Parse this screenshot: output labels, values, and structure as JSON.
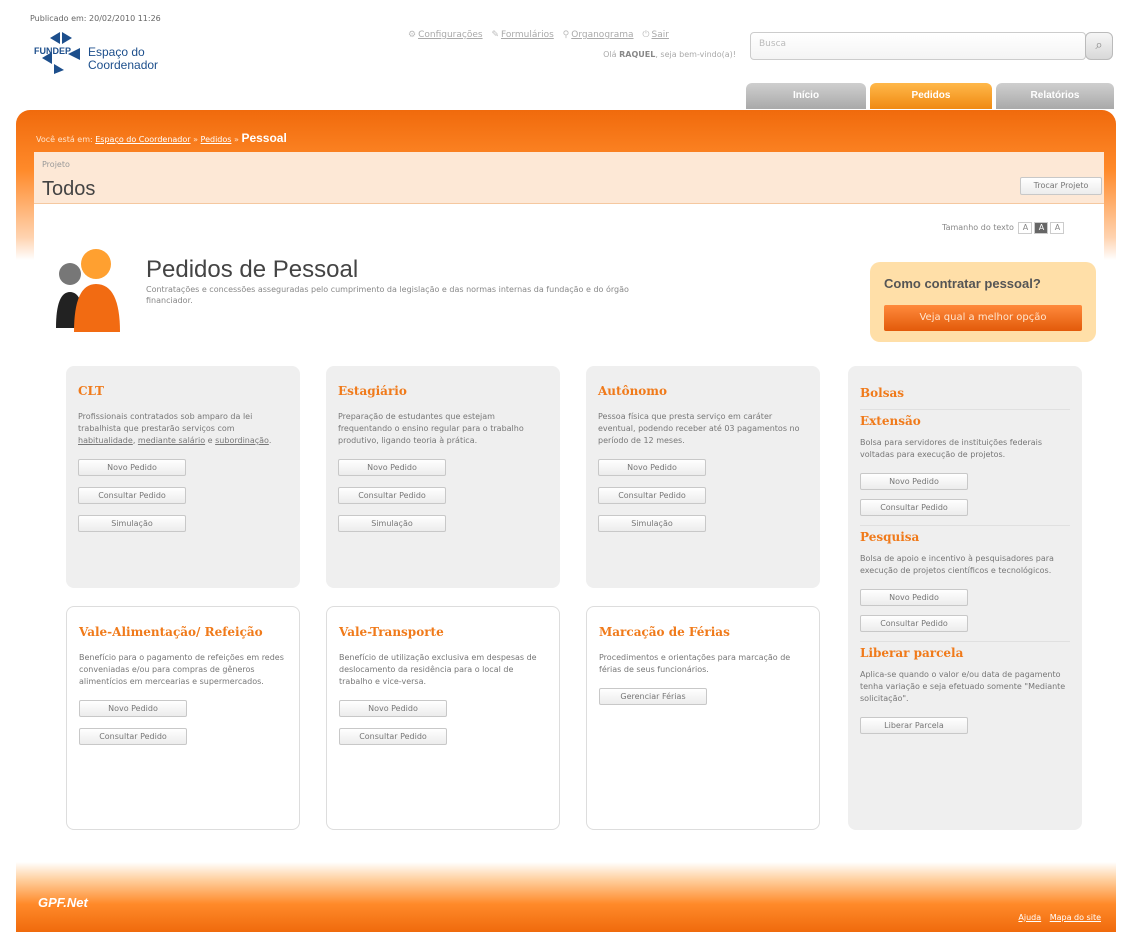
{
  "published": "Publicado em: 20/02/2010 11:26",
  "logo": {
    "brand": "FUNDEP",
    "line1": "Espaço do",
    "line2": "Coordenador"
  },
  "topnav": {
    "config": "Configurações",
    "forms": "Formulários",
    "org": "Organograma",
    "help": "Sair"
  },
  "greeting": {
    "prefix": "Olá",
    "name": "RAQUEL",
    "suffix": ", seja bem-vindo(a)!"
  },
  "search": {
    "placeholder": "Busca"
  },
  "tabs": [
    "Início",
    "Pedidos",
    "Relatórios"
  ],
  "breadcrumb": {
    "prefix": "Você está em:",
    "link1": "Espaço do Coordenador",
    "link2": "Pedidos",
    "current": "Pessoal"
  },
  "project": {
    "label": "Projeto",
    "name": "Todos",
    "change_button": "Trocar Projeto"
  },
  "text_size": {
    "label": "Tamanho do texto",
    "options": [
      "A",
      "A",
      "A"
    ]
  },
  "hero": {
    "title": "Pedidos de Pessoal",
    "description": "Contratações e concessões asseguradas pelo cumprimento da legislação e das normas internas da fundação e do órgão financiador."
  },
  "como": {
    "title": "Como contratar pessoal?",
    "button": "Veja qual a melhor opção"
  },
  "cards": {
    "clt": {
      "title": "CLT",
      "desc_pre": "Profissionais contratados sob amparo da lei trabalhista que prestarão serviços com ",
      "link1": "habitualidade",
      "mid": ", ",
      "link2": "mediante salário",
      "mid2": " e ",
      "link3": "subordinação",
      "end": ".",
      "buttons": [
        "Novo Pedido",
        "Consultar Pedido",
        "Simulação"
      ]
    },
    "estagiario": {
      "title": "Estagiário",
      "desc": "Preparação de estudantes que estejam frequentando o ensino regular para o trabalho produtivo, ligando teoria à prática.",
      "buttons": [
        "Novo Pedido",
        "Consultar Pedido",
        "Simulação"
      ]
    },
    "autonomo": {
      "title": "Autônomo",
      "desc": "Pessoa física que presta serviço em caráter eventual, podendo receber até 03 pagamentos no período de 12 meses.",
      "buttons": [
        "Novo Pedido",
        "Consultar Pedido",
        "Simulação"
      ]
    },
    "bolsas": {
      "title": "Bolsas",
      "extensao": {
        "title": "Extensão",
        "desc": "Bolsa para servidores de instituições federais voltadas para execução de projetos.",
        "buttons": [
          "Novo Pedido",
          "Consultar Pedido"
        ]
      },
      "pesquisa": {
        "title": "Pesquisa",
        "desc": "Bolsa de apoio e incentivo à pesquisadores para execução de projetos científicos e tecnológicos.",
        "buttons": [
          "Novo Pedido",
          "Consultar Pedido"
        ]
      },
      "liberar": {
        "title": "Liberar parcela",
        "desc": "Aplica-se quando o valor e/ou data de pagamento tenha variação e seja efetuado somente \"Mediante solicitação\".",
        "buttons": [
          "Liberar Parcela"
        ]
      }
    },
    "vale_alimentacao": {
      "title": "Vale-Alimentação/ Refeição",
      "desc": "Benefício para o pagamento de refeições em redes conveniadas e/ou para compras de gêneros alimentícios em mercearias e supermercados.",
      "buttons": [
        "Novo Pedido",
        "Consultar Pedido"
      ]
    },
    "vale_transporte": {
      "title": "Vale-Transporte",
      "desc": "Benefício de utilização exclusiva em despesas de deslocamento da residência para o local de trabalho e vice-versa.",
      "buttons": [
        "Novo Pedido",
        "Consultar Pedido"
      ]
    },
    "ferias": {
      "title": "Marcação de Férias",
      "desc": "Procedimentos e orientações para marcação de férias de seus funcionários.",
      "buttons": [
        "Gerenciar Férias"
      ]
    }
  },
  "footer": {
    "logo": "GPF.Net",
    "links": [
      "Ajuda",
      "Mapa do site"
    ]
  },
  "colors": {
    "accent": "#f07a1a",
    "brand_blue": "#1d4f8c"
  }
}
